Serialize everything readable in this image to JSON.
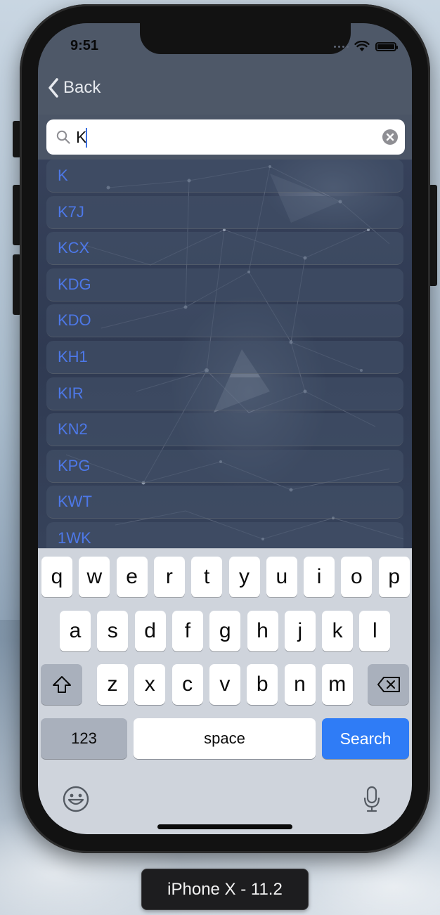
{
  "simulator": {
    "label": "iPhone X - 11.2"
  },
  "status_bar": {
    "time": "9:51"
  },
  "nav": {
    "back_label": "Back"
  },
  "search": {
    "value": "K",
    "placeholder": ""
  },
  "results": [
    "K",
    "K7J",
    "KCX",
    "KDG",
    "KDO",
    "KH1",
    "KIR",
    "KN2",
    "KPG",
    "KWT",
    "1WK"
  ],
  "keyboard": {
    "row1": [
      "q",
      "w",
      "e",
      "r",
      "t",
      "y",
      "u",
      "i",
      "o",
      "p"
    ],
    "row2": [
      "a",
      "s",
      "d",
      "f",
      "g",
      "h",
      "j",
      "k",
      "l"
    ],
    "row3": [
      "z",
      "x",
      "c",
      "v",
      "b",
      "n",
      "m"
    ],
    "numbers_label": "123",
    "space_label": "space",
    "return_label": "Search"
  },
  "colors": {
    "accent": "#2f7cf6",
    "result_text": "#4d78e8",
    "keyboard_bg": "#cfd4dc"
  },
  "icons": {
    "back": "chevron-left-icon",
    "search": "magnifier-icon",
    "clear": "clear-circle-icon",
    "shift": "shift-arrow-icon",
    "delete": "backspace-icon",
    "emoji": "emoji-face-icon",
    "mic": "microphone-icon",
    "wifi": "wifi-icon",
    "battery": "battery-icon"
  }
}
